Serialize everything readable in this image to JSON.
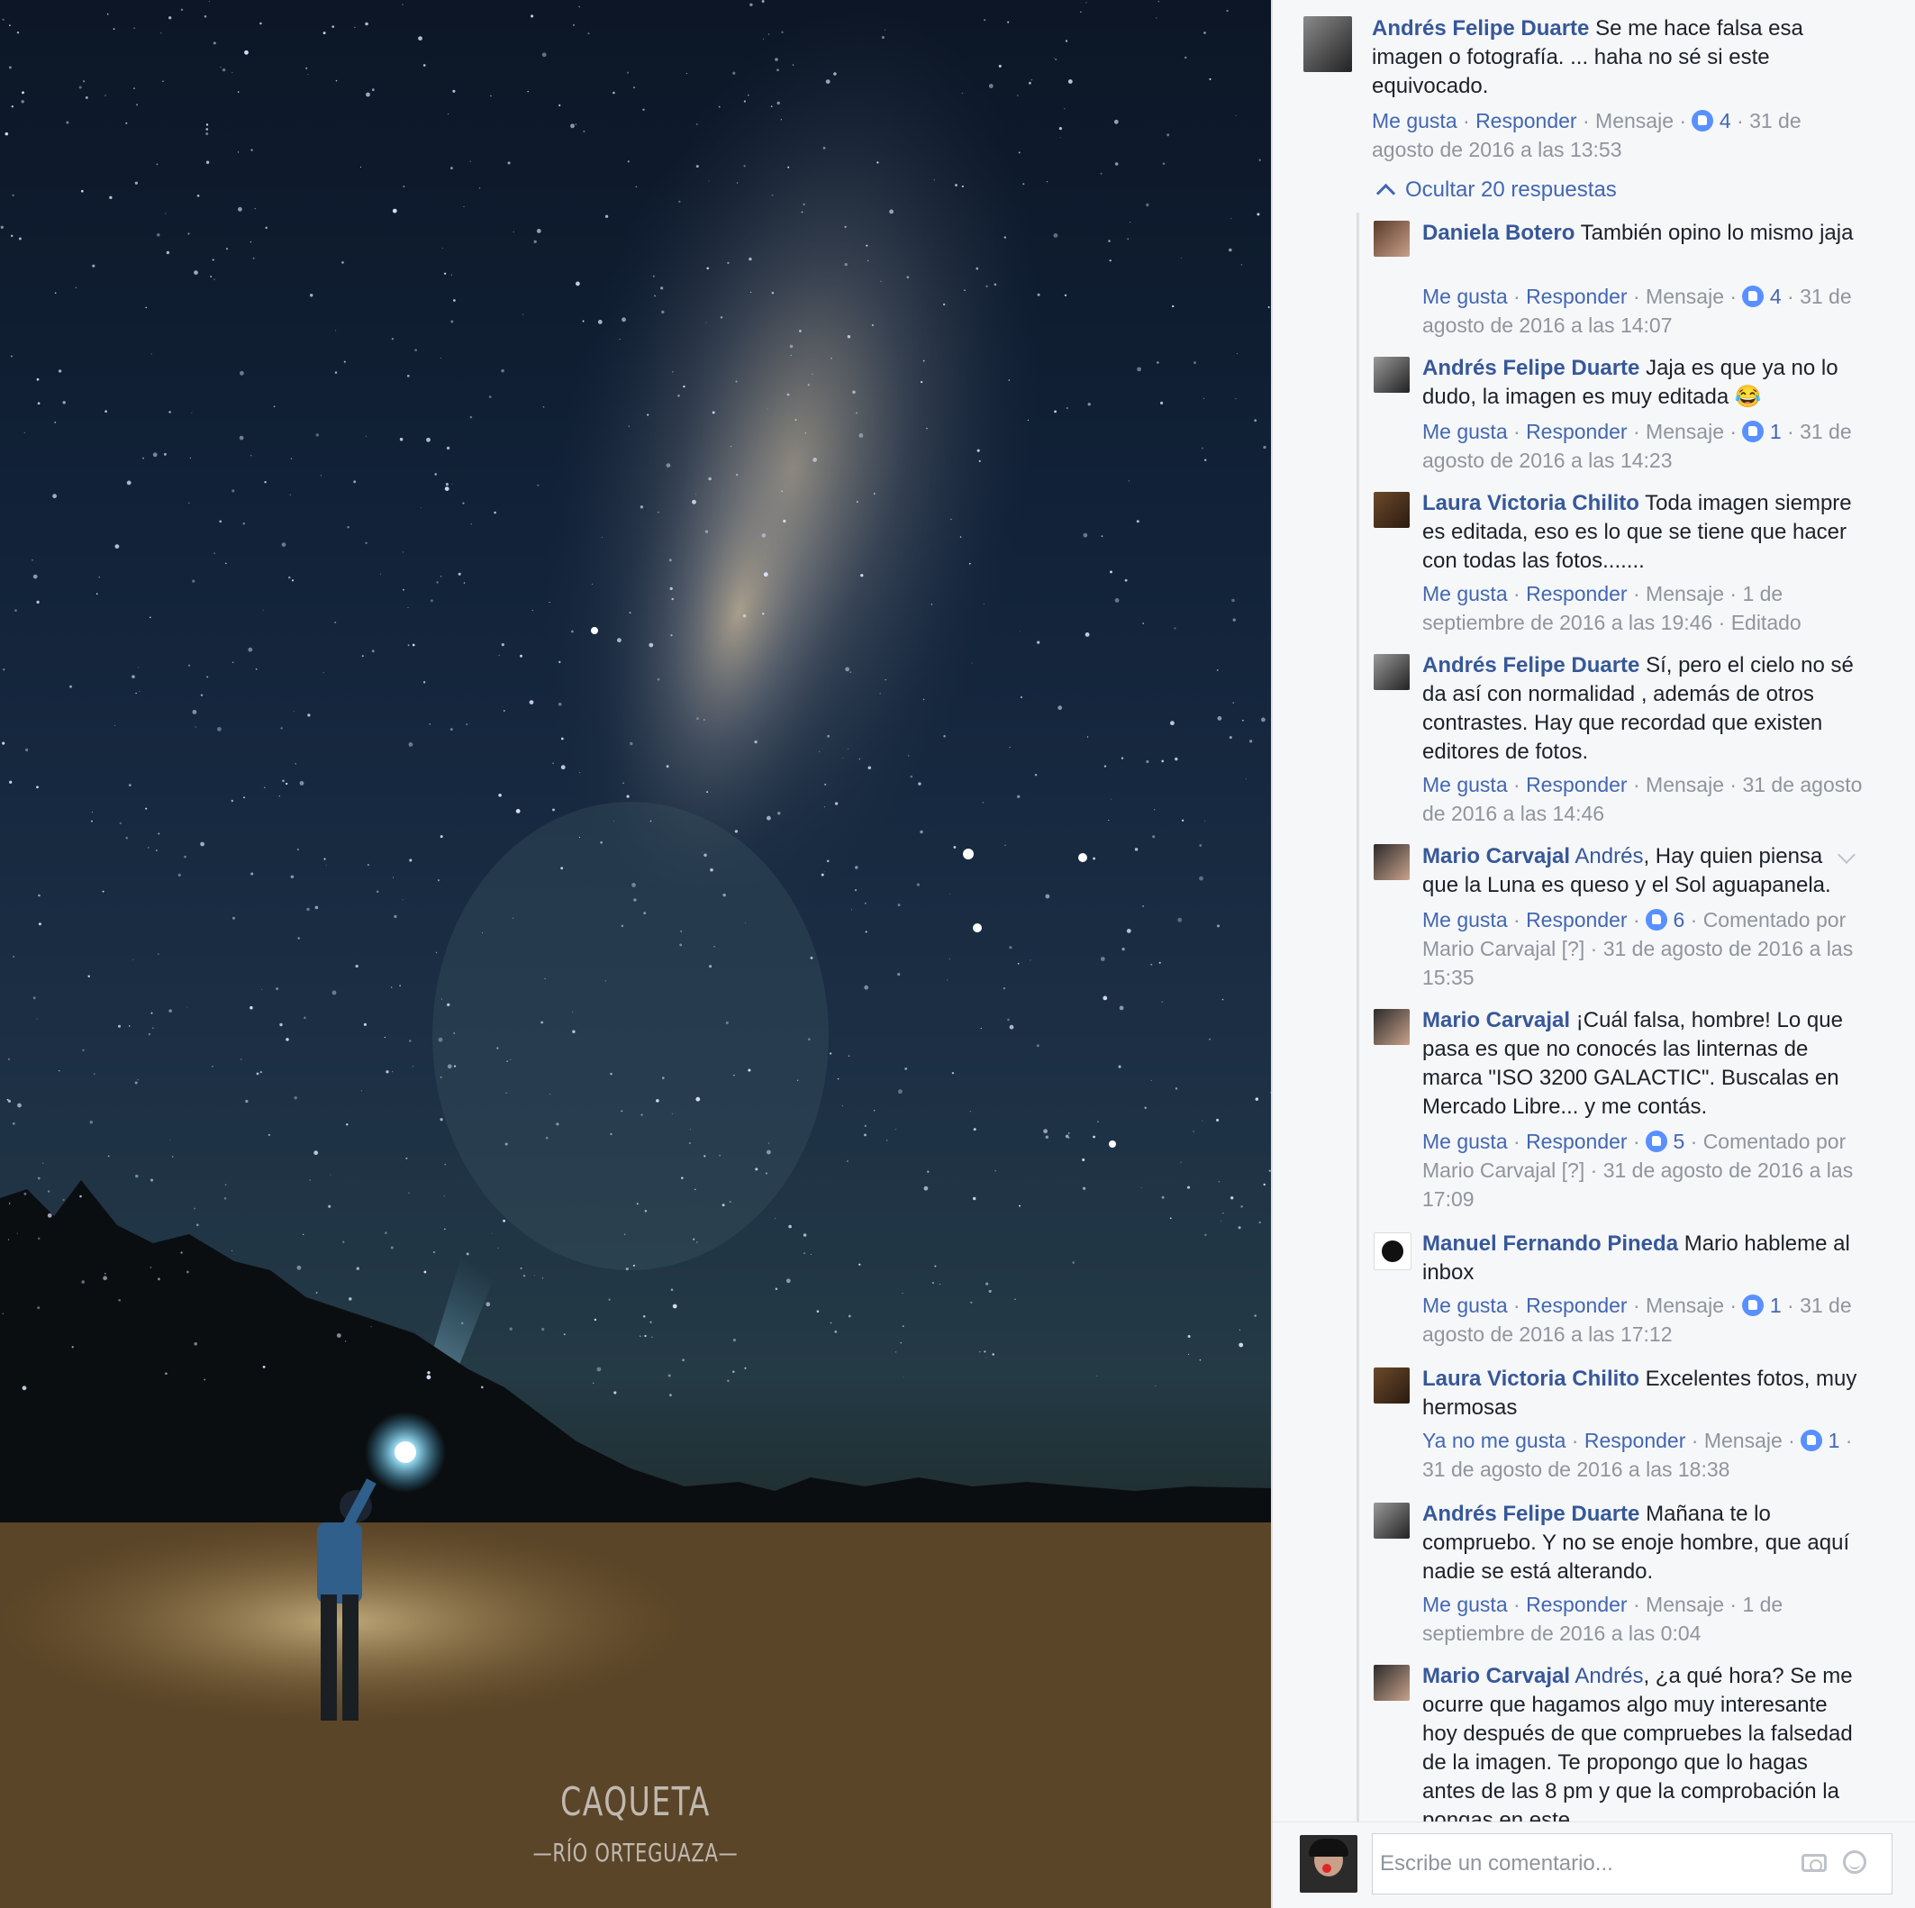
{
  "photo": {
    "watermark_title": "CAQUETA",
    "watermark_subtitle": "—RÍO ORTEGUAZA—"
  },
  "actions": {
    "like": "Me gusta",
    "unlike": "Ya no me gusta",
    "reply": "Responder",
    "message": "Mensaje",
    "sep": " · "
  },
  "main_comment": {
    "author": "Andrés Felipe Duarte",
    "text": " Se me hace falsa esa imagen o fotografía. ... haha no sé si este equivocado.",
    "likes": "4",
    "time": "31 de agosto de 2016 a las 13:53"
  },
  "hide_replies": "Ocultar 20 respuestas",
  "replies": [
    {
      "author": "Daniela Botero",
      "text": " También opino lo mismo jaja",
      "likes": "4",
      "time": "31 de agosto de 2016 a las 14:07"
    },
    {
      "author": "Andrés Felipe Duarte",
      "text": " Jaja es que ya no lo dudo, la imagen es muy editada 😂",
      "likes": "1",
      "time": "31 de agosto de 2016 a las 14:23"
    },
    {
      "author": "Laura Victoria Chilito",
      "text": " Toda imagen siempre es editada, eso es lo que se tiene que hacer con todas las fotos.......",
      "time": "1 de septiembre de 2016 a las 19:46",
      "edited": "Editado"
    },
    {
      "author": "Andrés Felipe Duarte",
      "text": " Sí, pero el cielo no sé da así con normalidad , además de otros contrastes. Hay que recordad que existen editores de fotos.",
      "time": "31 de agosto de 2016 a las 14:46"
    },
    {
      "author": "Mario Carvajal",
      "mention": " Andrés",
      "text": ", Hay quien piensa que la Luna es queso y el Sol aguapanela.",
      "likes": "6",
      "commented_by": "Comentado por Mario Carvajal",
      "flag": "[?]",
      "time": "31 de agosto de 2016 a las 15:35"
    },
    {
      "author": "Mario Carvajal",
      "text": " ¡Cuál falsa, hombre! Lo que pasa es que no conocés las linternas de marca \"ISO 3200 GALACTIC\". Buscalas en Mercado Libre... y me contás.",
      "likes": "5",
      "commented_by": "Comentado por Mario Carvajal",
      "flag": "[?]",
      "time": "31 de agosto de 2016 a las 17:09"
    },
    {
      "author": "Manuel Fernando Pineda",
      "text": " Mario hableme al inbox",
      "likes": "1",
      "time": "31 de agosto de 2016 a las 17:12"
    },
    {
      "author": "Laura Victoria Chilito",
      "text": " Excelentes fotos, muy hermosas",
      "likes": "1",
      "time": "31 de agosto de 2016 a las 18:38"
    },
    {
      "author": "Andrés Felipe Duarte",
      "text": " Mañana te lo compruebo. Y no se enoje hombre, que aquí nadie se está alterando.",
      "time": "1 de septiembre de 2016 a las 0:04"
    },
    {
      "author": "Mario Carvajal",
      "mention": " Andrés",
      "text": ", ¿a qué hora? Se me ocurre que hagamos algo muy interesante hoy después de que compruebes la falsedad de la imagen. Te propongo que lo hagas antes de las 8 pm y que la comprobación la pongas en este"
    }
  ],
  "compose": {
    "placeholder": "Escribe un comentario..."
  },
  "colors": {
    "link": "#4267b2",
    "name": "#365899",
    "meta": "#90949c",
    "like_badge": "#5890ff",
    "pane_bg": "#f6f7f9"
  },
  "icons": [
    "like-badge-icon",
    "chevron-up-icon",
    "chevron-down-icon",
    "camera-icon",
    "emoji-icon",
    "laughing-emoji-icon"
  ]
}
